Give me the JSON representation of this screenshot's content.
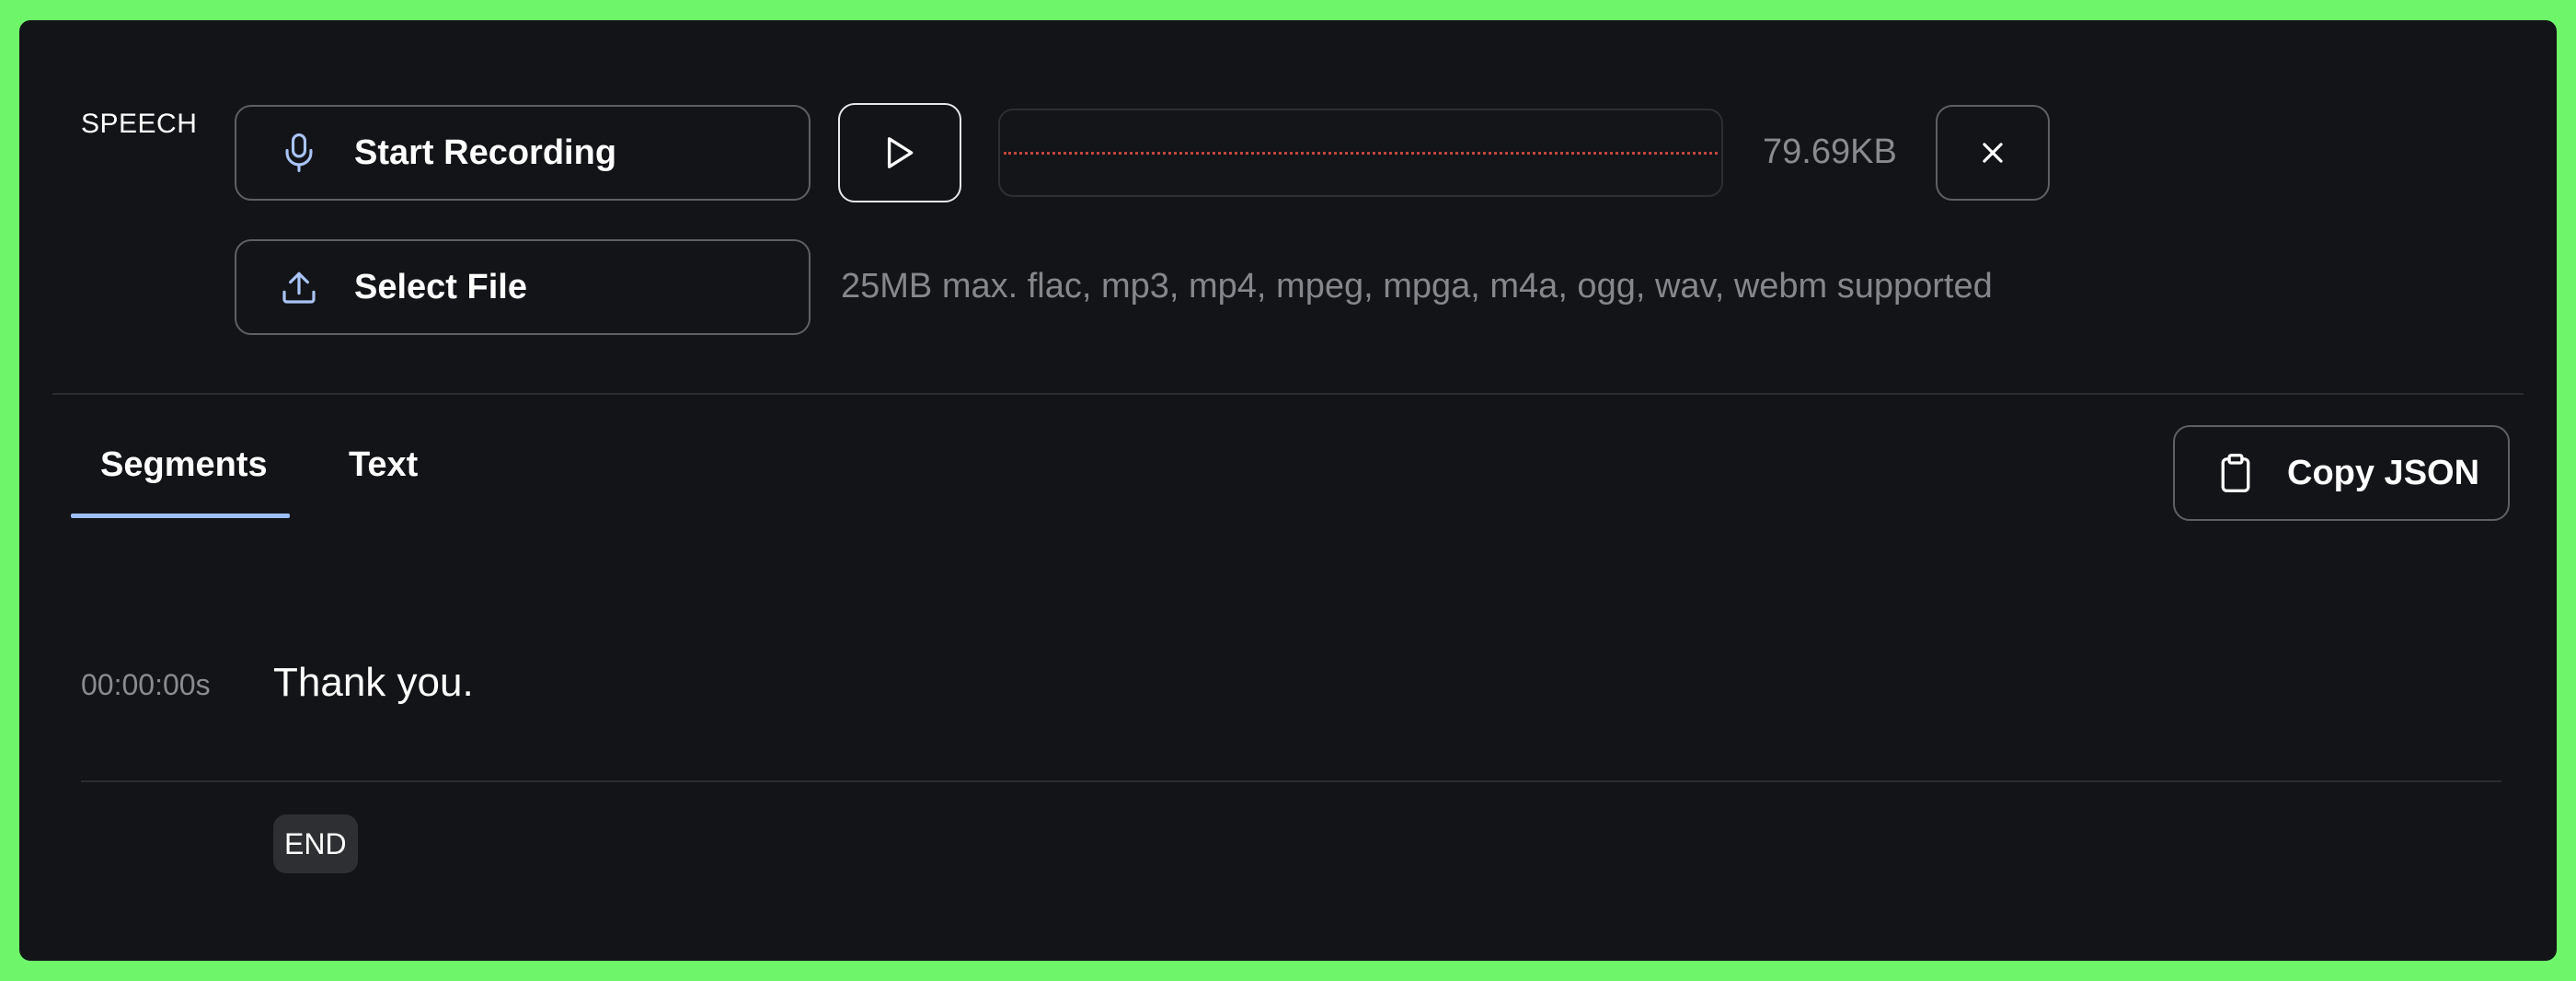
{
  "speech": {
    "label": "SPEECH",
    "record_button_label": "Start Recording",
    "select_file_label": "Select File",
    "file_size": "79.69KB",
    "hint": "25MB max. flac, mp3, mp4, mpeg, mpga, m4a, ogg, wav, webm supported"
  },
  "tabs": [
    {
      "label": "Segments",
      "active": true
    },
    {
      "label": "Text",
      "active": false
    }
  ],
  "toolbar": {
    "copy_label": "Copy JSON"
  },
  "segments": [
    {
      "timestamp": "00:00:00s",
      "text": "Thank you."
    }
  ],
  "end_label": "END",
  "icons": {
    "record": "microphone-icon",
    "select_file": "upload-icon",
    "play": "play-icon",
    "close": "close-icon",
    "copy": "clipboard-icon"
  },
  "colors": {
    "background": "#131418",
    "frame": "#6ef56a",
    "accent_tab": "#9dbff7",
    "icon_blue": "#a9c4f5",
    "waveform": "#c2463c"
  }
}
